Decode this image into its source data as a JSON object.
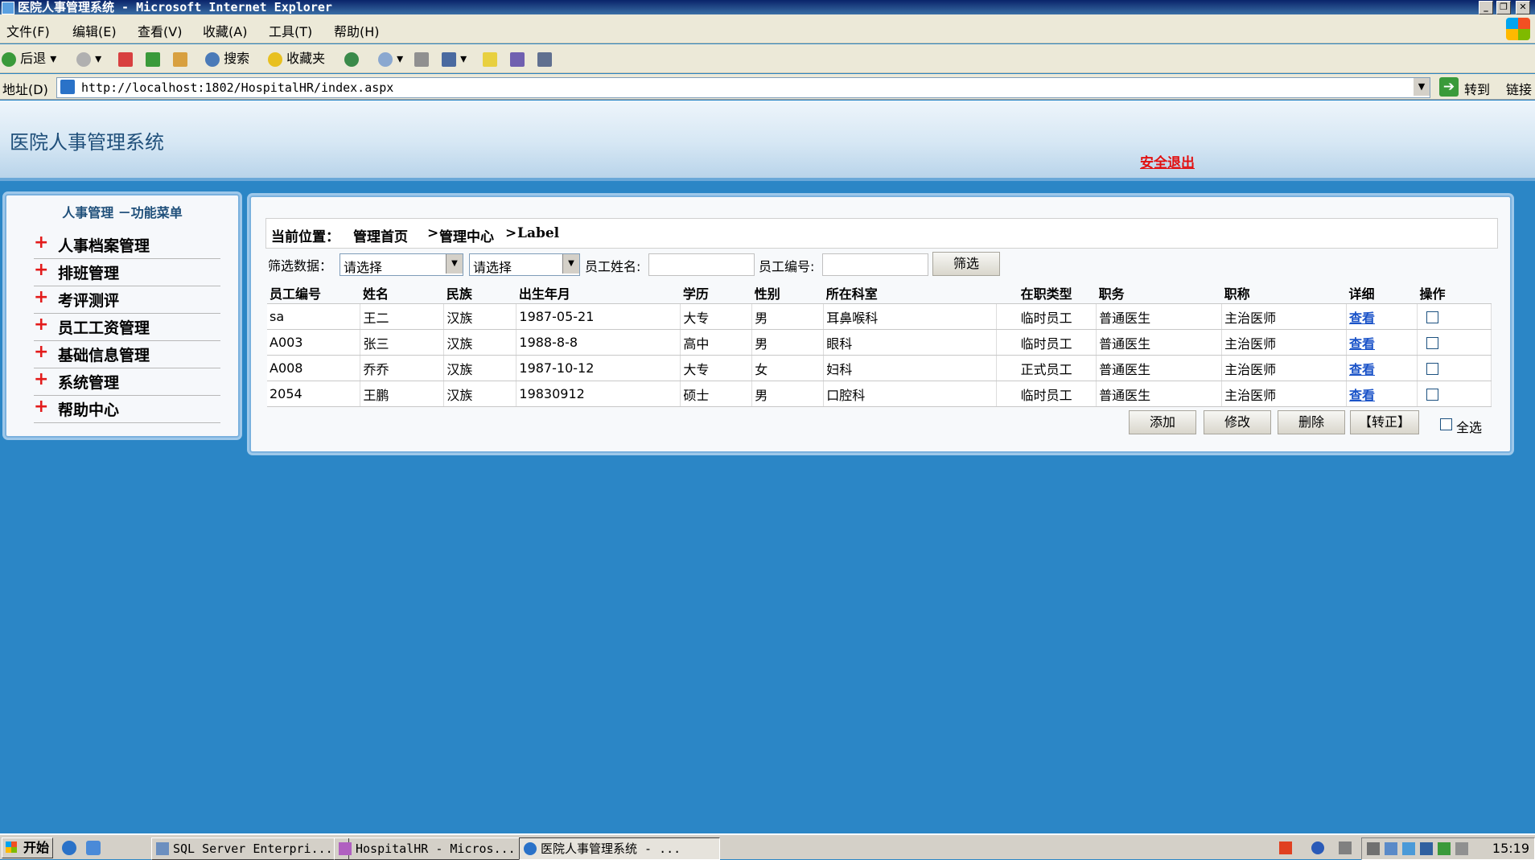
{
  "window": {
    "title": "医院人事管理系统 - Microsoft Internet Explorer"
  },
  "menu": [
    "文件(F)",
    "编辑(E)",
    "查看(V)",
    "收藏(A)",
    "工具(T)",
    "帮助(H)"
  ],
  "toolbar": {
    "back_label": "后退",
    "search_label": "搜索",
    "favorites_label": "收藏夹"
  },
  "address": {
    "label": "地址(D)",
    "url": "http://localhost:1802/HospitalHR/index.aspx",
    "go_label": "转到",
    "links_label": "链接"
  },
  "page": {
    "app_title": "医院人事管理系统",
    "logout_label": "安全退出"
  },
  "sidebar": {
    "heading": "人事管理 －功能菜单",
    "items": [
      "人事档案管理",
      "排班管理",
      "考评测评",
      "员工工资管理",
      "基础信息管理",
      "系统管理",
      "帮助中心"
    ]
  },
  "breadcrumb": {
    "prefix": "当前位置：",
    "home": "管理首页",
    "center": "管理中心",
    "current": "Label",
    "sep": ">"
  },
  "filter": {
    "label": "筛选数据：",
    "select1_value": "请选择",
    "select2_value": "请选择",
    "name_label": "员工姓名:",
    "name_value": "",
    "id_label": "员工编号:",
    "id_value": "",
    "button_label": "筛选"
  },
  "table": {
    "headers": [
      "员工编号",
      "姓名",
      "民族",
      "出生年月",
      "学历",
      "性别",
      "所在科室",
      "在职类型",
      "职务",
      "职称",
      "详细",
      "操作"
    ],
    "rows": [
      {
        "id": "sa",
        "name": "王二",
        "ethnicity": "汉族",
        "birth": "1987-05-21",
        "education": "大专",
        "gender": "男",
        "department": "耳鼻喉科",
        "type": "临时员工",
        "post": "普通医生",
        "title": "主治医师",
        "detail": "查看"
      },
      {
        "id": "A003",
        "name": "张三",
        "ethnicity": "汉族",
        "birth": "1988-8-8",
        "education": "高中",
        "gender": "男",
        "department": "眼科",
        "type": "临时员工",
        "post": "普通医生",
        "title": "主治医师",
        "detail": "查看"
      },
      {
        "id": "A008",
        "name": "乔乔",
        "ethnicity": "汉族",
        "birth": "1987-10-12",
        "education": "大专",
        "gender": "女",
        "department": "妇科",
        "type": "正式员工",
        "post": "普通医生",
        "title": "主治医师",
        "detail": "查看"
      },
      {
        "id": "2054",
        "name": "王鹏",
        "ethnicity": "汉族",
        "birth": "19830912",
        "education": "硕士",
        "gender": "男",
        "department": "口腔科",
        "type": "临时员工",
        "post": "普通医生",
        "title": "主治医师",
        "detail": "查看"
      }
    ]
  },
  "actions": {
    "add": "添加",
    "edit": "修改",
    "delete": "删除",
    "convert": "【转正】",
    "select_all": "全选"
  },
  "taskbar": {
    "start_label": "开始",
    "tasks": [
      "SQL Server Enterpri...",
      "HospitalHR - Micros...",
      "医院人事管理系统 - ..."
    ],
    "clock": "15:19"
  },
  "colors": {
    "page_background": "#2b86c6",
    "logout_red": "#e21010",
    "menu_plus_red": "#e31b1b",
    "link_blue": "#1a53c8"
  }
}
